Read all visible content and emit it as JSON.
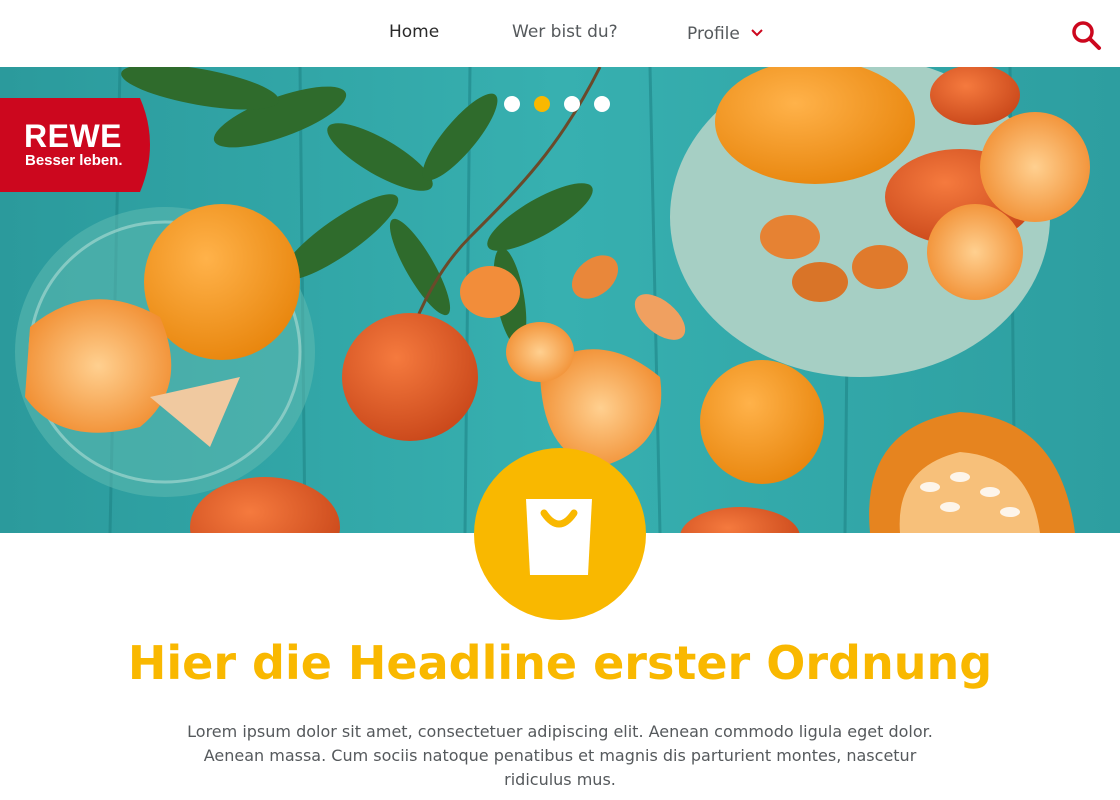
{
  "nav": {
    "items": [
      {
        "label": "Home"
      },
      {
        "label": "Wer bist du?"
      },
      {
        "label": "Profile"
      }
    ]
  },
  "slider": {
    "total": 4,
    "active_index": 1
  },
  "brand": {
    "title": "REWE",
    "subtitle": "Besser leben."
  },
  "content": {
    "headline": "Hier die Headline erster Ordnung",
    "body": "Lorem ipsum dolor sit amet, consectetuer adipiscing elit. Aenean commodo ligula eget dolor. Aenean massa. Cum sociis natoque penatibus et magnis dis parturient montes, nascetur ridiculus mus."
  },
  "icons": {
    "search": "search-icon",
    "dropdown": "chevron-down-icon",
    "bag": "shopping-bag-icon"
  },
  "colors": {
    "accent": "#f9b800",
    "brand_red": "#cc071e",
    "teal": "#2aa3a4"
  }
}
